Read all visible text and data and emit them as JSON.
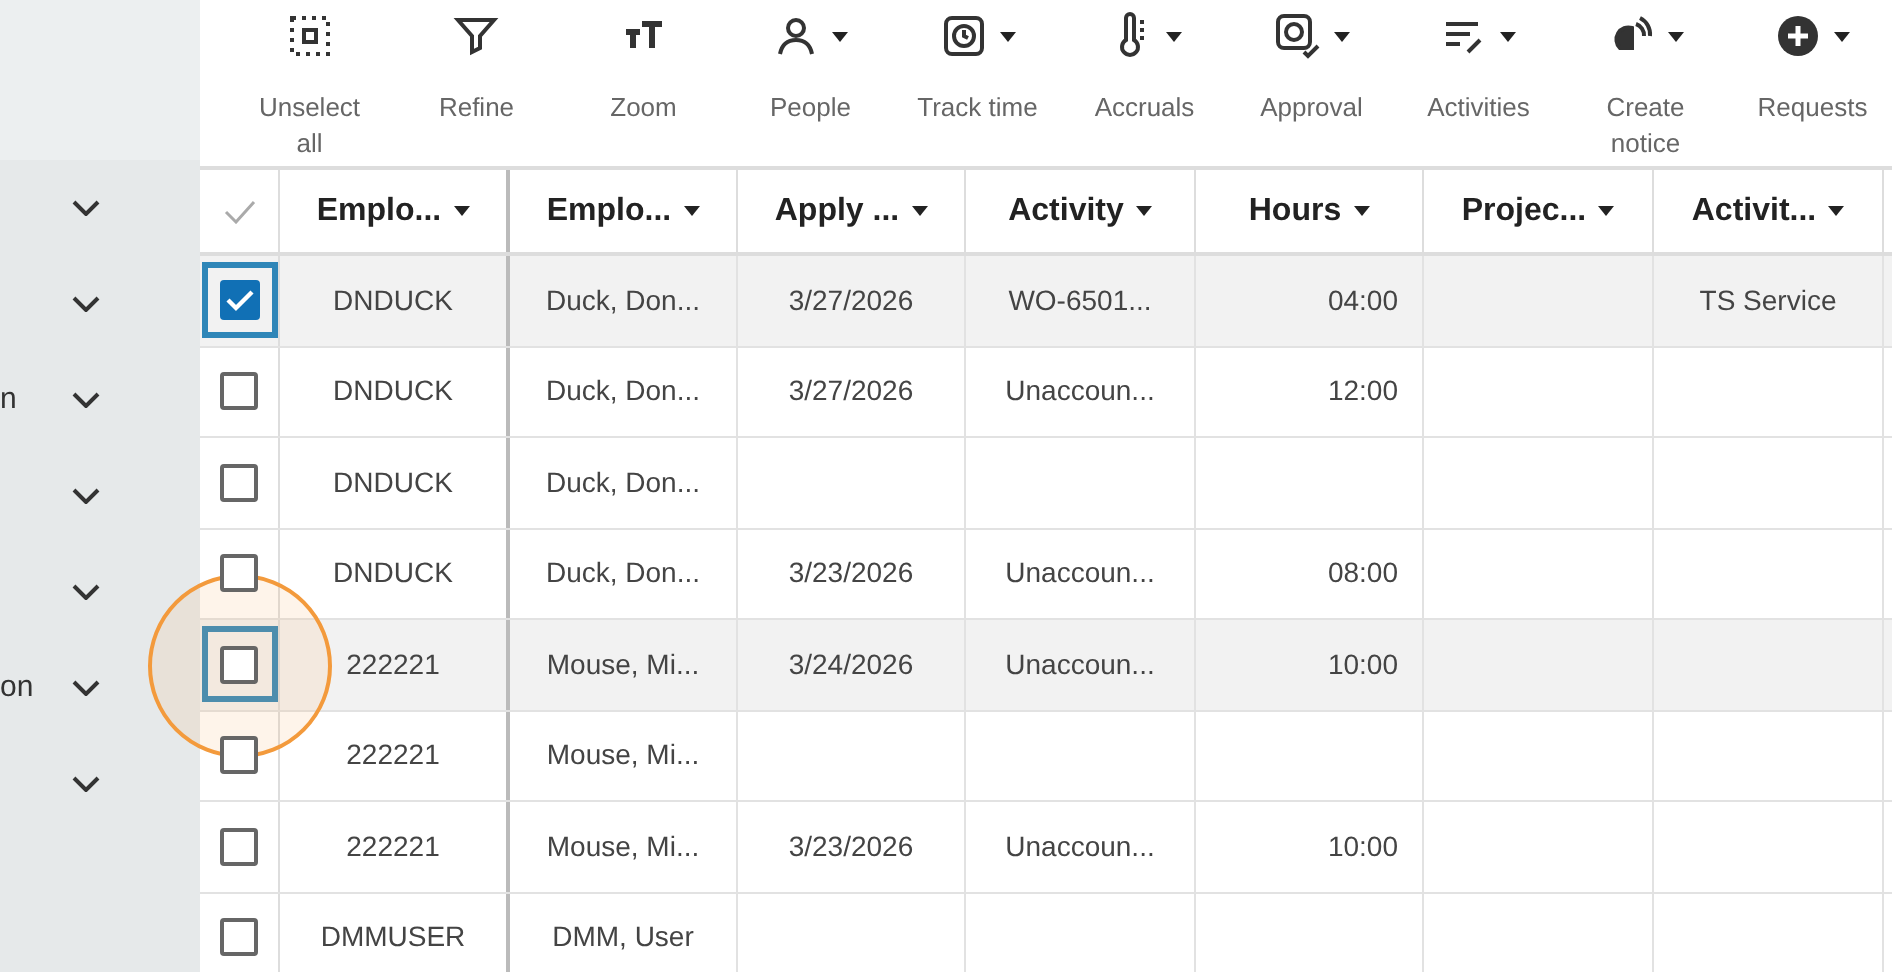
{
  "sidebar": {
    "items": [
      {
        "expanded": false
      },
      {
        "expanded": false
      },
      {
        "label": "n",
        "expanded": false
      },
      {
        "expanded": false
      },
      {
        "expanded": false
      },
      {
        "label": "on",
        "expanded": false
      },
      {
        "expanded": false
      }
    ]
  },
  "toolbar": [
    {
      "label": "Unselect all",
      "dropdown": false
    },
    {
      "label": "Refine",
      "dropdown": false
    },
    {
      "label": "Zoom",
      "dropdown": false
    },
    {
      "label": "People",
      "dropdown": true
    },
    {
      "label": "Track time",
      "dropdown": true
    },
    {
      "label": "Accruals",
      "dropdown": true
    },
    {
      "label": "Approval",
      "dropdown": true
    },
    {
      "label": "Activities",
      "dropdown": true
    },
    {
      "label": "Create notice",
      "dropdown": true
    },
    {
      "label": "Requests",
      "dropdown": true
    }
  ],
  "table": {
    "all_checked": false,
    "columns": [
      {
        "label": "Emplo...",
        "kind": "text"
      },
      {
        "label": "Emplo...",
        "kind": "text"
      },
      {
        "label": "Apply ...",
        "kind": "text"
      },
      {
        "label": "Activity",
        "kind": "text"
      },
      {
        "label": "Hours",
        "kind": "number"
      },
      {
        "label": "Projec...",
        "kind": "text"
      },
      {
        "label": "Activit...",
        "kind": "text"
      }
    ],
    "rows": [
      {
        "checked": true,
        "highlighted": true,
        "focused": true,
        "clicked": false,
        "cells": [
          "DNDUCK",
          "Duck, Don...",
          "3/27/2026",
          "WO-6501...",
          "04:00",
          "",
          "TS Service"
        ]
      },
      {
        "checked": false,
        "highlighted": false,
        "focused": false,
        "clicked": false,
        "cells": [
          "DNDUCK",
          "Duck, Don...",
          "3/27/2026",
          "Unaccoun...",
          "12:00",
          "",
          ""
        ]
      },
      {
        "checked": false,
        "highlighted": false,
        "focused": false,
        "clicked": false,
        "cells": [
          "DNDUCK",
          "Duck, Don...",
          "",
          "",
          "",
          "",
          ""
        ]
      },
      {
        "checked": false,
        "highlighted": false,
        "focused": false,
        "clicked": false,
        "cells": [
          "DNDUCK",
          "Duck, Don...",
          "3/23/2026",
          "Unaccoun...",
          "08:00",
          "",
          ""
        ]
      },
      {
        "checked": false,
        "highlighted": true,
        "focused": true,
        "clicked": true,
        "cells": [
          "222221",
          "Mouse, Mi...",
          "3/24/2026",
          "Unaccoun...",
          "10:00",
          "",
          ""
        ]
      },
      {
        "checked": false,
        "highlighted": false,
        "focused": false,
        "clicked": false,
        "cells": [
          "222221",
          "Mouse, Mi...",
          "",
          "",
          "",
          "",
          ""
        ]
      },
      {
        "checked": false,
        "highlighted": false,
        "focused": false,
        "clicked": false,
        "cells": [
          "222221",
          "Mouse, Mi...",
          "3/23/2026",
          "Unaccoun...",
          "10:00",
          "",
          ""
        ]
      },
      {
        "checked": false,
        "highlighted": false,
        "focused": false,
        "clicked": false,
        "cells": [
          "DMMUSER",
          "DMM, User",
          "",
          "",
          "",
          "",
          ""
        ]
      }
    ]
  }
}
